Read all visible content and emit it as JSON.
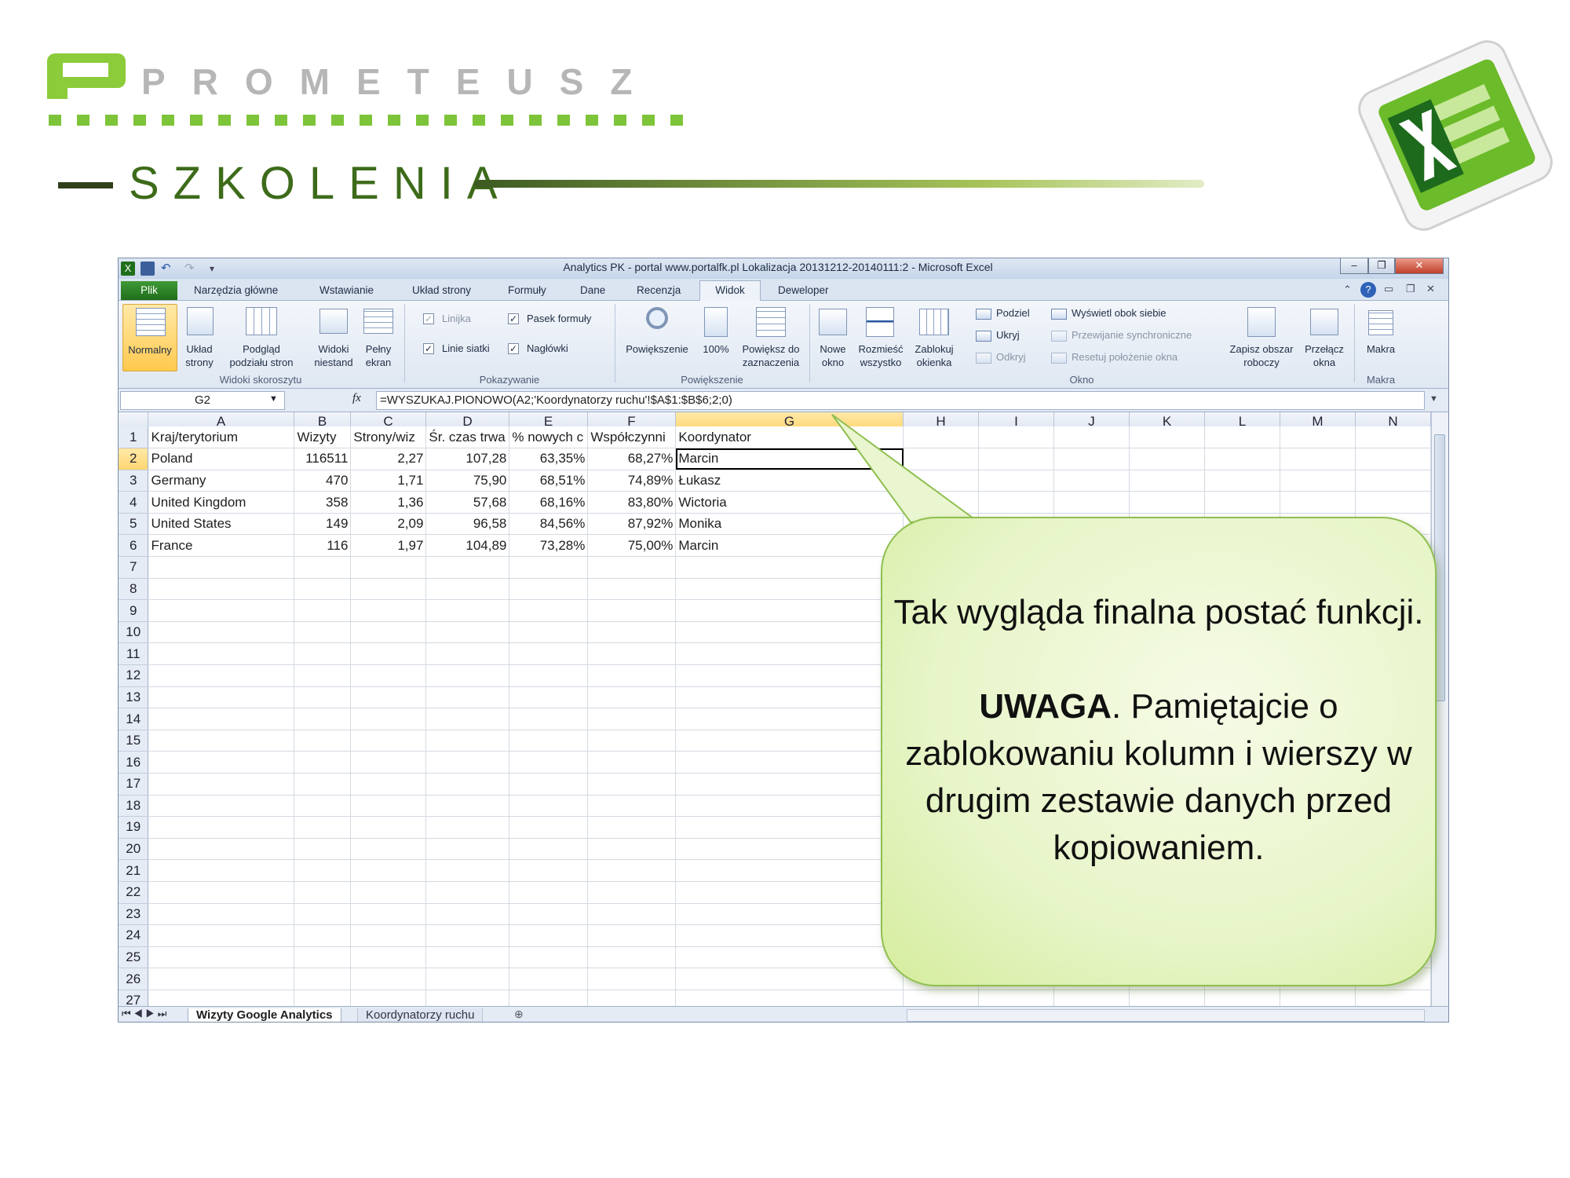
{
  "brand": {
    "name": "PROMETEUSZ",
    "subtitle": "SZKOLENIA"
  },
  "excel": {
    "window_title": "Analytics PK - portal www.portalfk.pl Lokalizacja 20131212-20140111:2  -  Microsoft Excel",
    "tabs": [
      "Plik",
      "Narzędzia główne",
      "Wstawianie",
      "Układ strony",
      "Formuły",
      "Dane",
      "Recenzja",
      "Widok",
      "Deweloper"
    ],
    "active_tab": "Widok",
    "ribbon": {
      "widoki_skoroszytu": {
        "label": "Widoki skoroszytu",
        "normalny": "Normalny",
        "uklad_strony_1": "Układ",
        "uklad_strony_2": "strony",
        "podglad_1": "Podgląd",
        "podglad_2": "podziału stron",
        "widoki_niestand_1": "Widoki",
        "widoki_niestand_2": "niestand",
        "pelny_ekran_1": "Pełny",
        "pelny_ekran_2": "ekran"
      },
      "pokazywanie": {
        "label": "Pokazywanie",
        "linijka": "Linijka",
        "pasek_formuly": "Pasek formuły",
        "linie_siatki": "Linie siatki",
        "naglowki": "Nagłówki"
      },
      "powiekszenie": {
        "label": "Powiększenie",
        "powiekszenie": "Powiększenie",
        "sto": "100%",
        "do_zazn_1": "Powiększ do",
        "do_zazn_2": "zaznaczenia"
      },
      "okno": {
        "label": "Okno",
        "nowe_1": "Nowe",
        "nowe_2": "okno",
        "rozmiesc_1": "Rozmieść",
        "rozmiesc_2": "wszystko",
        "zablokuj_1": "Zablokuj",
        "zablokuj_2": "okienka",
        "podziel": "Podziel",
        "ukryj": "Ukryj",
        "odkryj": "Odkryj",
        "wyswietl": "Wyświetl obok siebie",
        "przewijanie": "Przewijanie synchroniczne",
        "resetuj": "Resetuj położenie okna",
        "zapisz_1": "Zapisz obszar",
        "zapisz_2": "roboczy",
        "przelacz_1": "Przełącz",
        "przelacz_2": "okna"
      },
      "makra": {
        "label": "Makra",
        "makra": "Makra"
      }
    },
    "name_box": "G2",
    "fx": "fx",
    "formula": "=WYSZUKAJ.PIONOWO(A2;'Koordynatorzy ruchu'!$A$1:$B$6;2;0)",
    "columns": [
      "A",
      "B",
      "C",
      "D",
      "E",
      "F",
      "G",
      "H",
      "I",
      "J",
      "K",
      "L",
      "M",
      "N"
    ],
    "header_row": [
      "Kraj/terytorium",
      "Wizyty",
      "Strony/wiz",
      "Śr. czas trwa",
      "% nowych c",
      "Współczynni",
      "Koordynator"
    ],
    "rows": [
      [
        "Poland",
        "116511",
        "2,27",
        "107,28",
        "63,35%",
        "68,27%",
        "Marcin"
      ],
      [
        "Germany",
        "470",
        "1,71",
        "75,90",
        "68,51%",
        "74,89%",
        "Łukasz"
      ],
      [
        "United Kingdom",
        "358",
        "1,36",
        "57,68",
        "68,16%",
        "83,80%",
        "Wictoria"
      ],
      [
        "United States",
        "149",
        "2,09",
        "96,58",
        "84,56%",
        "87,92%",
        "Monika"
      ],
      [
        "France",
        "116",
        "1,97",
        "104,89",
        "73,28%",
        "75,00%",
        "Marcin"
      ]
    ],
    "row_numbers": [
      "1",
      "2",
      "3",
      "4",
      "5",
      "6",
      "7",
      "8",
      "9",
      "10",
      "11",
      "12",
      "13",
      "14",
      "15",
      "16",
      "17",
      "18",
      "19",
      "20",
      "21",
      "22",
      "23",
      "24",
      "25",
      "26",
      "27"
    ],
    "sheet_tabs": [
      "Wizyty Google Analytics",
      "Koordynatorzy ruchu"
    ],
    "active_sheet": "Wizyty Google Analytics"
  },
  "callout": {
    "line1": "Tak wygląda finalna postać funkcji.",
    "uwaga_bold": "UWAGA",
    "line2": ". Pamiętajcie o zablokowaniu kolumn i wierszy w drugim zestawie danych przed kopiowaniem."
  },
  "colors": {
    "brand_green": "#7ec43a",
    "excel_green": "#1f6e1b",
    "callout_fill": "#e7f5c8"
  }
}
